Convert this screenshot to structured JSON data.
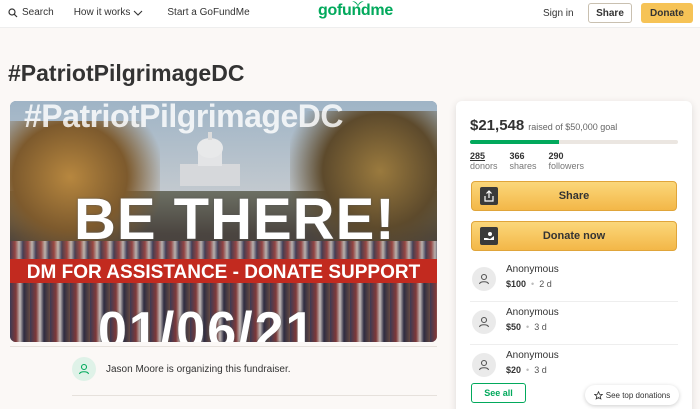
{
  "header": {
    "search_label": "Search",
    "how_it_works_label": "How it works",
    "start_label": "Start a GoFundMe",
    "logo_text": "gofundme",
    "signin_label": "Sign in",
    "share_label": "Share",
    "donate_label": "Donate"
  },
  "campaign": {
    "title": "#PatriotPilgrimageDC",
    "hero": {
      "hashtag": "#PatriotPilgrimageDC",
      "headline": "BE THERE!",
      "banner": "DM FOR ASSISTANCE - DONATE SUPPORT",
      "date": "01/06/21"
    },
    "organizer_text": "Jason Moore is organizing this fundraiser."
  },
  "sidebar": {
    "raised_amount": "$21,548",
    "raised_of": "raised of $50,000 goal",
    "progress_fraction": 0.43,
    "stats": [
      {
        "num": "285",
        "label": "donors"
      },
      {
        "num": "366",
        "label": "shares"
      },
      {
        "num": "290",
        "label": "followers"
      }
    ],
    "share_label": "Share",
    "donate_label": "Donate now",
    "donations": [
      {
        "name": "Anonymous",
        "amount": "$100",
        "time": "2 d"
      },
      {
        "name": "Anonymous",
        "amount": "$50",
        "time": "3 d"
      },
      {
        "name": "Anonymous",
        "amount": "$20",
        "time": "3 d"
      }
    ],
    "see_all_label": "See all",
    "see_top_label": "See top donations"
  },
  "colors": {
    "brand_green": "#02a95c",
    "donate_yellow": "#f6c356",
    "banner_red": "#c22a1f"
  }
}
